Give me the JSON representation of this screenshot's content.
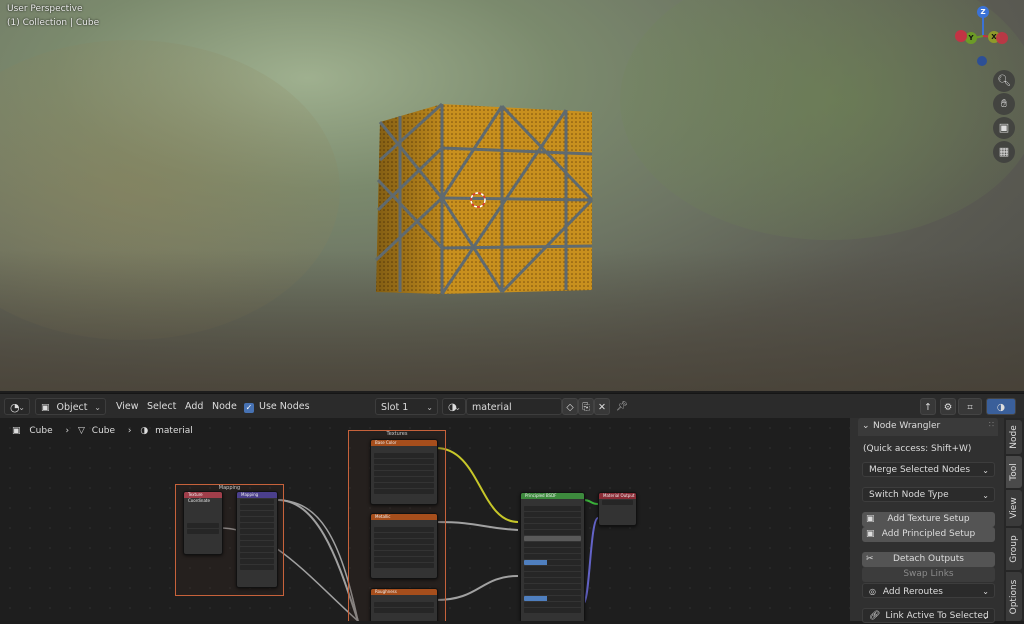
{
  "viewport": {
    "perspective_label": "User Perspective",
    "collection_label": "(1) Collection | Cube",
    "gizmo": {
      "z": "Z",
      "y": "Y",
      "x": "X"
    },
    "nav_icons": [
      "zoom-icon",
      "hand-pan-icon",
      "camera-icon",
      "grid-ortho-icon"
    ]
  },
  "header": {
    "editor_type_icon": "node-editor-icon",
    "mode": "Object",
    "menus": [
      "View",
      "Select",
      "Add",
      "Node"
    ],
    "use_nodes_label": "Use Nodes",
    "use_nodes_checked": true,
    "slot": "Slot 1",
    "material_name": "material"
  },
  "breadcrumb": {
    "object": "Cube",
    "mesh": "Cube",
    "material": "material"
  },
  "nodes": {
    "mapping_frame": "Mapping",
    "textures_frame": "Textures",
    "texcoord_title": "Texture Coordinate",
    "mapping_title": "Mapping",
    "basecolor_title": "Base Color",
    "metallic_title": "Metallic",
    "roughness_title": "Roughness",
    "bsdf_title": "Principled BSDF",
    "output_title": "Material Output"
  },
  "npanel": {
    "title": "Node Wrangler",
    "quick_access": "(Quick access: Shift+W)",
    "merge_selected": "Merge Selected Nodes",
    "switch_type": "Switch Node Type",
    "add_texture_setup": "Add Texture Setup",
    "add_principled_setup": "Add Principled Setup",
    "detach_outputs": "Detach Outputs",
    "swap_links": "Swap Links",
    "add_reroutes": "Add Reroutes",
    "link_active": "Link Active To Selected"
  },
  "tabs": [
    "Node",
    "Tool",
    "View",
    "Group",
    "Options"
  ],
  "colors": {
    "frame_border": "#c7623b",
    "bsdf_header": "#3d8a3d",
    "output_header": "#8a2c36",
    "mapping_header": "#4b3f8c",
    "texcoord_header": "#a03e4a",
    "texture_header": "#a64e1c",
    "link_yellow": "#c7c729",
    "link_grey": "#a1a1a1",
    "link_blue": "#6363c7"
  }
}
